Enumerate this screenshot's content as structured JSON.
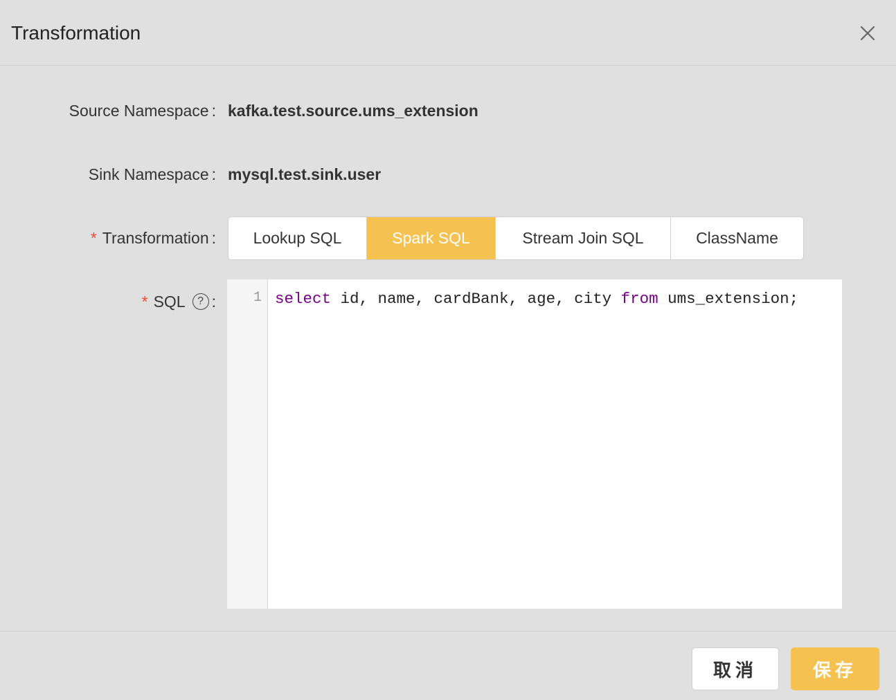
{
  "modal": {
    "title": "Transformation",
    "close_icon": "close-icon"
  },
  "form": {
    "source_namespace": {
      "label": "Source Namespace",
      "colon": ":",
      "value": "kafka.test.source.ums_extension"
    },
    "sink_namespace": {
      "label": "Sink Namespace",
      "colon": ":",
      "value": "mysql.test.sink.user"
    },
    "transformation": {
      "required_mark": "*",
      "label": "Transformation",
      "colon": ":",
      "options": [
        {
          "label": "Lookup SQL",
          "active": false
        },
        {
          "label": "Spark SQL",
          "active": true
        },
        {
          "label": "Stream Join SQL",
          "active": false
        },
        {
          "label": "ClassName",
          "active": false
        }
      ]
    },
    "sql": {
      "required_mark": "*",
      "label": "SQL",
      "help_glyph": "?",
      "help_icon": "question-circle-icon",
      "colon": ":",
      "editor": {
        "line_numbers": [
          "1"
        ],
        "tokens": [
          {
            "text": "select",
            "keyword": true
          },
          {
            "text": " id, name, cardBank, age, city ",
            "keyword": false
          },
          {
            "text": "from",
            "keyword": true
          },
          {
            "text": " ums_extension;",
            "keyword": false
          }
        ]
      }
    }
  },
  "footer": {
    "cancel_label": "取消",
    "save_label": "保存"
  },
  "colors": {
    "accent": "#f5c150",
    "required": "#e54b3c",
    "keyword": "#770088",
    "background": "#e0e0e0"
  }
}
